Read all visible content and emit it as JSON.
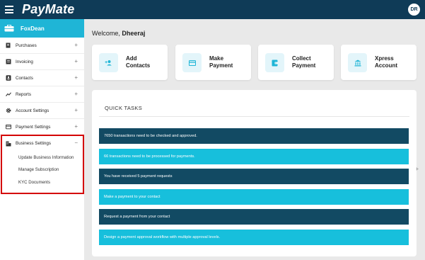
{
  "header": {
    "logo": "PayMate",
    "avatar_initials": "DR",
    "bg_color": "#0f3b57"
  },
  "sidebar": {
    "org_name": "FoxDean",
    "accent_color": "#1fb5d6",
    "items": [
      {
        "label": "Purchases",
        "icon": "cart-icon",
        "toggle": "+"
      },
      {
        "label": "Invoicing",
        "icon": "invoice-icon",
        "toggle": "+"
      },
      {
        "label": "Contacts",
        "icon": "contacts-icon",
        "toggle": "+"
      },
      {
        "label": "Reports",
        "icon": "trend-icon",
        "toggle": "+"
      },
      {
        "label": "Account Settings",
        "icon": "gear-icon",
        "toggle": "+"
      },
      {
        "label": "Payment Settings",
        "icon": "card-icon",
        "toggle": "+"
      },
      {
        "label": "Business Settings",
        "icon": "building-icon",
        "toggle": "−"
      }
    ],
    "sub_items": [
      {
        "label": "Update Business Information",
        "toggle": ""
      },
      {
        "label": "Manage Subscription",
        "toggle": "+"
      },
      {
        "label": "KYC Documents",
        "toggle": ""
      }
    ]
  },
  "welcome": {
    "prefix": "Welcome,",
    "name": "Dheeraj"
  },
  "cards": [
    {
      "line1": "Add",
      "line2": "Contacts",
      "icon": "add-contact-icon"
    },
    {
      "line1": "Make",
      "line2": "Payment",
      "icon": "card-icon"
    },
    {
      "line1": "Collect",
      "line2": "Payment",
      "icon": "wallet-icon"
    },
    {
      "line1": "Xpress",
      "line2": "Account",
      "icon": "bank-icon"
    }
  ],
  "quick_tasks": {
    "title": "QUICK TASKS",
    "tasks": [
      {
        "text": "7650 transactions need to be checked and approved.",
        "style": "dark"
      },
      {
        "text": "66 transactions need to be processed for payments.",
        "style": "light"
      },
      {
        "text": "You have received 5 payment requests",
        "style": "dark"
      },
      {
        "text": "Make a payment to your contact",
        "style": "light"
      },
      {
        "text": "Request a payment from your contact",
        "style": "dark"
      },
      {
        "text": "Design a payment approval workflow with multiple approval levels.",
        "style": "light"
      }
    ]
  }
}
